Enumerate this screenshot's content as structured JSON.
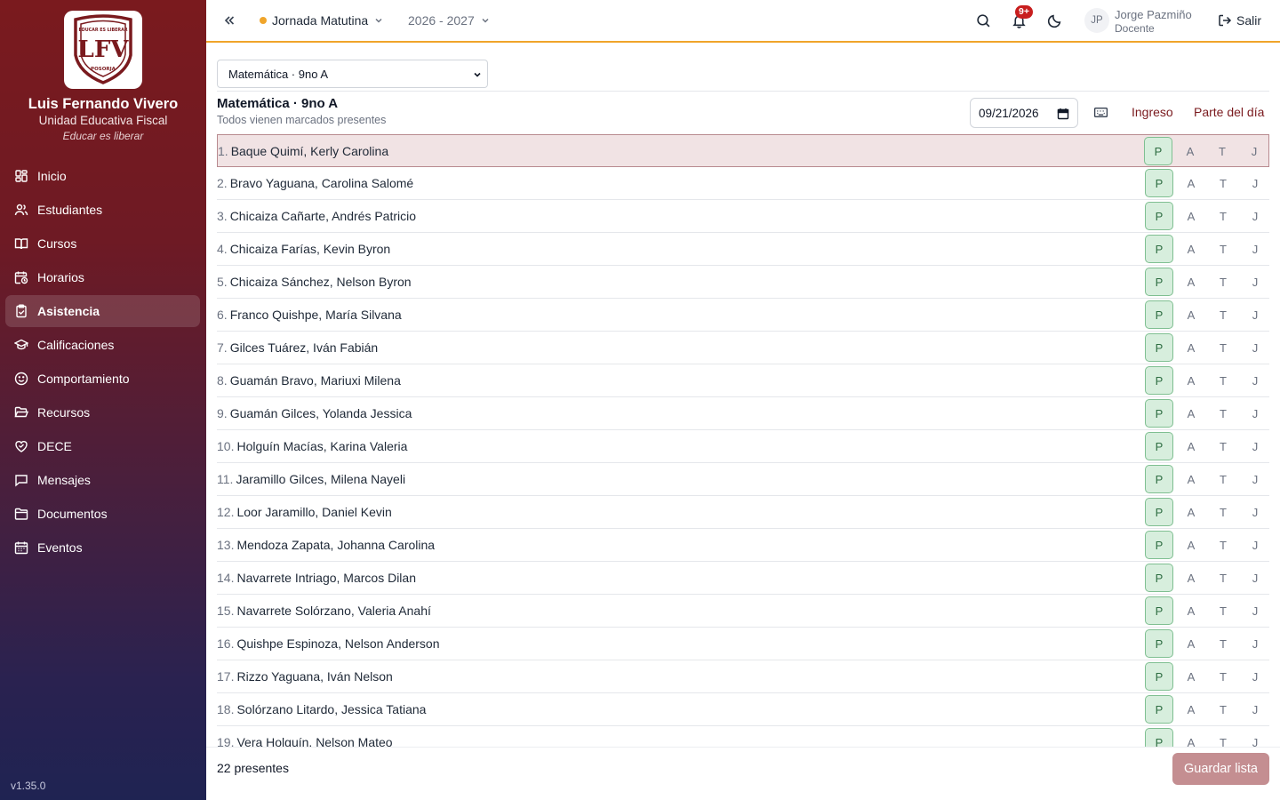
{
  "sidebar": {
    "logo_text": "LFV",
    "logo_top_text": "EDUCAR ES LIBERAR",
    "logo_bottom_text": "POSORJA",
    "school_name": "Luis Fernando Vivero",
    "school_type": "Unidad Educativa Fiscal",
    "motto": "Educar es liberar",
    "items": [
      {
        "label": "Inicio",
        "icon": "dashboard-icon"
      },
      {
        "label": "Estudiantes",
        "icon": "users-icon"
      },
      {
        "label": "Cursos",
        "icon": "book-icon"
      },
      {
        "label": "Horarios",
        "icon": "calendar-clock-icon"
      },
      {
        "label": "Asistencia",
        "icon": "clipboard-check-icon",
        "active": true
      },
      {
        "label": "Calificaciones",
        "icon": "graduation-cap-icon"
      },
      {
        "label": "Comportamiento",
        "icon": "smile-icon"
      },
      {
        "label": "Recursos",
        "icon": "folder-open-icon"
      },
      {
        "label": "DECE",
        "icon": "heart-handshake-icon"
      },
      {
        "label": "Mensajes",
        "icon": "message-icon"
      },
      {
        "label": "Documentos",
        "icon": "folder-icon"
      },
      {
        "label": "Eventos",
        "icon": "calendar-icon"
      }
    ],
    "version": "v1.35.0"
  },
  "header": {
    "jornada": "Jornada Matutina",
    "school_year": "2026 - 2027",
    "notifications_badge": "9+",
    "user_initials": "JP",
    "user_name": "Jorge Pazmiño",
    "user_role": "Docente",
    "logout_label": "Salir"
  },
  "main": {
    "course_select_value": "Matemática · 9no A",
    "title": "Matemática · 9no A",
    "subtitle": "Todos vienen marcados presentes",
    "date": "09/21/2026",
    "ingreso_label": "Ingreso",
    "parte_label": "Parte del día",
    "options": [
      "P",
      "A",
      "T",
      "J"
    ],
    "students": [
      {
        "num": "1.",
        "name": "Baque Quimí, Kerly Carolina"
      },
      {
        "num": "2.",
        "name": "Bravo Yaguana, Carolina Salomé"
      },
      {
        "num": "3.",
        "name": "Chicaiza Cañarte, Andrés Patricio"
      },
      {
        "num": "4.",
        "name": "Chicaiza Farías, Kevin Byron"
      },
      {
        "num": "5.",
        "name": "Chicaiza Sánchez, Nelson Byron"
      },
      {
        "num": "6.",
        "name": "Franco Quishpe, María Silvana"
      },
      {
        "num": "7.",
        "name": "Gilces Tuárez, Iván Fabián"
      },
      {
        "num": "8.",
        "name": "Guamán Bravo, Mariuxi Milena"
      },
      {
        "num": "9.",
        "name": "Guamán Gilces, Yolanda Jessica"
      },
      {
        "num": "10.",
        "name": "Holguín Macías, Karina Valeria"
      },
      {
        "num": "11.",
        "name": "Jaramillo Gilces, Milena Nayeli"
      },
      {
        "num": "12.",
        "name": "Loor Jaramillo, Daniel Kevin"
      },
      {
        "num": "13.",
        "name": "Mendoza Zapata, Johanna Carolina"
      },
      {
        "num": "14.",
        "name": "Navarrete Intriago, Marcos Dilan"
      },
      {
        "num": "15.",
        "name": "Navarrete Solórzano, Valeria Anahí"
      },
      {
        "num": "16.",
        "name": "Quishpe Espinoza, Nelson Anderson"
      },
      {
        "num": "17.",
        "name": "Rizzo Yaguana, Iván Nelson"
      },
      {
        "num": "18.",
        "name": "Solórzano Litardo, Jessica Tatiana"
      },
      {
        "num": "19.",
        "name": "Vera Holguín, Nelson Mateo"
      }
    ],
    "present_count": "22 presentes",
    "save_label": "Guardar lista"
  },
  "colors": {
    "brand": "#7a1a1e",
    "accent": "#f0a52a",
    "present": "#d7eedd"
  }
}
